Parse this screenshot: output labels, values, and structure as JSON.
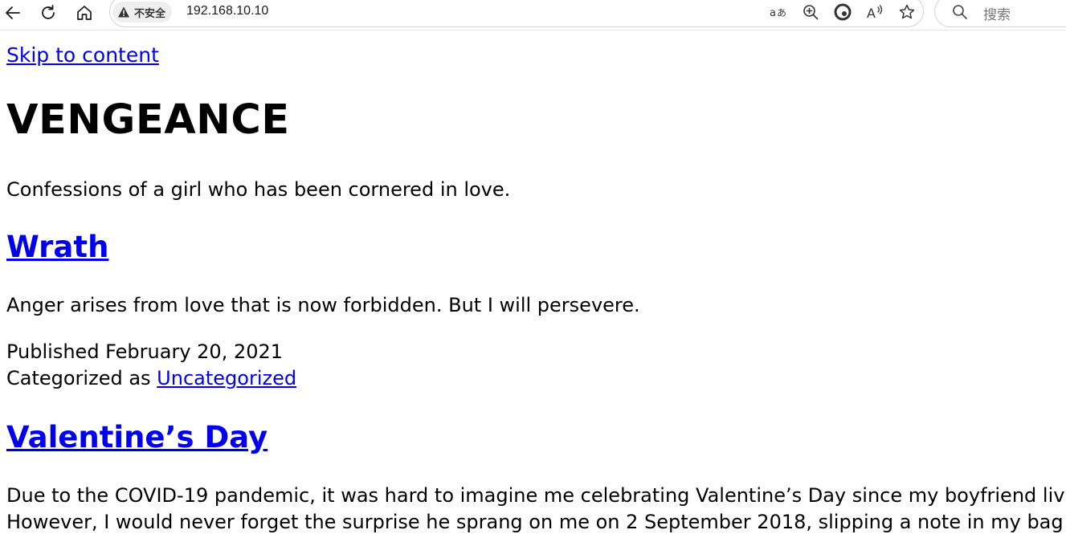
{
  "browser": {
    "security_label": "不安全",
    "url": "192.168.10.10",
    "search_placeholder": "搜索",
    "icons": [
      "back-icon",
      "refresh-icon",
      "home-icon",
      "warning-icon",
      "translate-icon",
      "zoom-icon",
      "edge-icon",
      "read-aloud-icon",
      "favorite-icon",
      "search-icon"
    ]
  },
  "page": {
    "skip_link": "Skip to content",
    "site_title": "VENGEANCE",
    "tagline": "Confessions of a girl who has been cornered in love.",
    "posts": [
      {
        "title": "Wrath",
        "excerpt": "Anger arises from love that is now forbidden. But I will persevere.",
        "published": "Published February 20, 2021",
        "categorized_prefix": "Categorized as ",
        "category": "Uncategorized"
      },
      {
        "title": "Valentine’s Day",
        "body_lines": [
          "Due to the COVID-19 pandemic, it was hard to imagine me celebrating Valentine’s Day since my boyfriend liv",
          "However, I would never forget the surprise he sprang on me on 2 September 2018, slipping a note in my bag e"
        ]
      }
    ]
  },
  "colors": {
    "link": "#0000ee",
    "text": "#000000"
  }
}
